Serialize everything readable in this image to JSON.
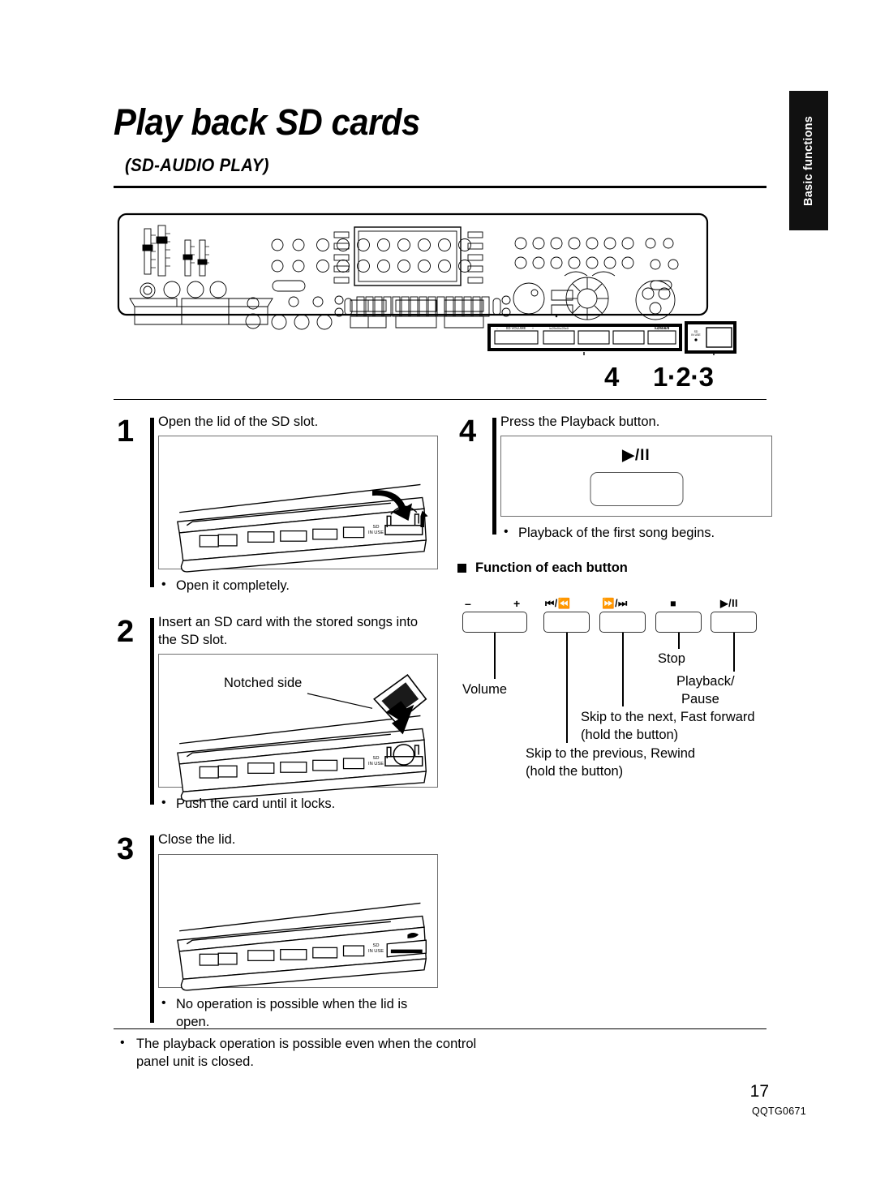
{
  "side_tab": {
    "label": "Basic functions"
  },
  "header": {
    "title": "Play back SD cards",
    "subtitle": "(SD-AUDIO PLAY)"
  },
  "device_panel": {
    "sd_volume_label": "SD VOLUME",
    "sd_in_use_label": "SD IN USE",
    "callouts": [
      {
        "name": "callout-4",
        "text": "4"
      },
      {
        "name": "callout-123",
        "text": "1·2·3"
      }
    ]
  },
  "steps": [
    {
      "number": "1",
      "title": "Open the lid of the SD slot.",
      "note": "Open it completely.",
      "figure_label": ""
    },
    {
      "number": "2",
      "title": "Insert an SD card with the stored songs into the SD slot.",
      "note": "Push the card until it locks.",
      "figure_label": "Notched side"
    },
    {
      "number": "3",
      "title": "Close the lid.",
      "note": "No operation is possible when the lid is open.",
      "figure_label": ""
    },
    {
      "number": "4",
      "title": "Press the Playback button.",
      "note": "Playback of the first song begins.",
      "figure_label": "▶/II"
    }
  ],
  "function_section": {
    "heading": "Function of each button",
    "buttons": [
      {
        "name": "volume-button",
        "symbol": "",
        "minus": "–",
        "plus": "+",
        "label": "Volume"
      },
      {
        "name": "previous-rewind-button",
        "symbol": "⏮/⏪",
        "label": "Skip to the previous, Rewind (hold the button)"
      },
      {
        "name": "next-fastforward-button",
        "symbol": "⏩/⏭",
        "label": "Skip to the next, Fast forward (hold the button)"
      },
      {
        "name": "stop-button",
        "symbol": "■",
        "label": "Stop"
      },
      {
        "name": "playback-pause-button",
        "symbol": "▶/II",
        "label": "Playback/ Pause"
      }
    ],
    "labels": {
      "volume": "Volume",
      "stop": "Stop",
      "playback_line1": "Playback/",
      "playback_line2": "Pause",
      "next_line1": "Skip to the next, Fast forward",
      "next_line2": "(hold the button)",
      "prev_line1": "Skip to the previous, Rewind",
      "prev_line2": "(hold the button)"
    }
  },
  "footer": {
    "note": "The playback operation is possible even when the control panel unit is closed.",
    "page_number": "17",
    "doc_id": "QQTG0671"
  }
}
